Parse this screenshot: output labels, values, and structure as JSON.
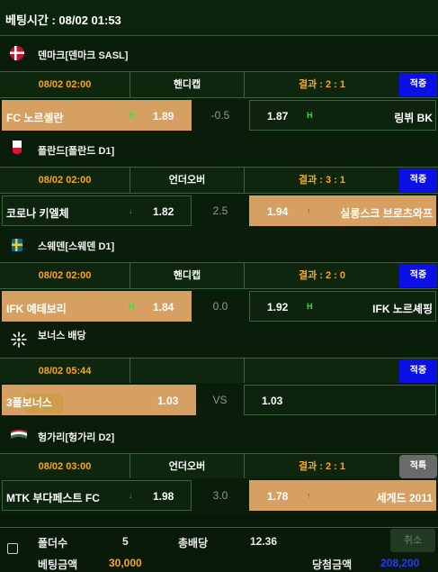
{
  "header": {
    "bet_time": "베팅시간 : 08/02 01:53"
  },
  "sections": [
    {
      "league": "덴마크[덴마크 SASL]",
      "flag": "denmark-flag-icon",
      "time": "08/02 02:00",
      "market": "핸디캡",
      "result": "결과 : 2 : 1",
      "status": "적중",
      "home": "FC 노르셸란",
      "home_odds": "1.89",
      "home_ind": "H",
      "mid": "-0.5",
      "away_odds": "1.87",
      "away_ind": "H",
      "away": "링뷔 BK"
    },
    {
      "league": "폴란드[폴란드 D1]",
      "flag": "poland-flag-icon",
      "time": "08/02 02:00",
      "market": "언더오버",
      "result": "결과 : 3 : 1",
      "status": "적중",
      "home": "코로나 키엘체",
      "home_odds": "1.82",
      "home_ind": "↓",
      "mid": "2.5",
      "away_odds": "1.94",
      "away_ind": "↑",
      "away": "실롱스크 브로츠와프"
    },
    {
      "league": "스웨덴[스웨덴 D1]",
      "flag": "sweden-flag-icon",
      "time": "08/02 02:00",
      "market": "핸디캡",
      "result": "결과 : 2 : 0",
      "status": "적중",
      "home": "IFK 예테보리",
      "home_odds": "1.84",
      "home_ind": "H",
      "mid": "0.0",
      "away_odds": "1.92",
      "away_ind": "H",
      "away": "IFK 노르셰핑"
    },
    {
      "league": "보너스 배당",
      "flag": "bonus-sparkle-icon",
      "time": "08/02 05:44",
      "market": "",
      "result": "",
      "status": "적중",
      "home": "3폴보너스",
      "home_odds": "1.03",
      "home_ind": "",
      "mid": "VS",
      "away_odds": "1.03",
      "away_ind": "",
      "away": ""
    },
    {
      "league": "헝가리[헝가리 D2]",
      "flag": "hungary-flag-icon",
      "time": "08/02 03:00",
      "market": "언더오버",
      "result": "결과 : 2 : 1",
      "status": "적특",
      "home": "MTK 부다페스트 FC",
      "home_odds": "1.98",
      "home_ind": "↓",
      "mid": "3.0",
      "away_odds": "1.78",
      "away_ind": "↑",
      "away": "세게드 2011"
    }
  ],
  "footer": {
    "folders_label": "폴더수",
    "folders_value": "5",
    "total_odds_label": "총배당",
    "total_odds_value": "12.36",
    "bet_amount_label": "베팅금액",
    "bet_amount_value": "30,000",
    "win_amount_label": "당첨금액",
    "win_amount_value": "208,200",
    "cancel_label": "취소"
  },
  "colors": {
    "accent_orange": "#f5a623",
    "win_blue": "#0a10e6",
    "selected_gold": "#d5a062"
  }
}
